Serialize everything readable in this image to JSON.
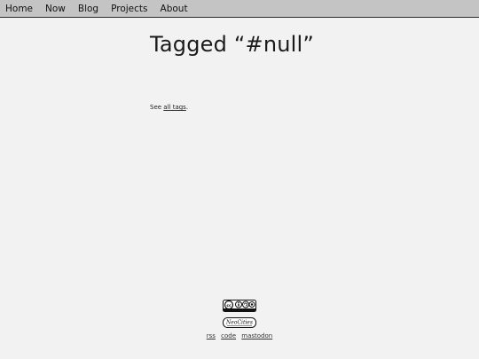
{
  "nav": {
    "items": [
      "Home",
      "Now",
      "Blog",
      "Projects",
      "About"
    ]
  },
  "page": {
    "title": "Tagged “#null”",
    "see_prefix": "See ",
    "see_link": "all tags",
    "see_suffix": "."
  },
  "footer": {
    "cc_badge": "cc by sa",
    "neocities_badge": "NeoCities",
    "links": [
      "rss",
      "code",
      "mastodon"
    ]
  }
}
